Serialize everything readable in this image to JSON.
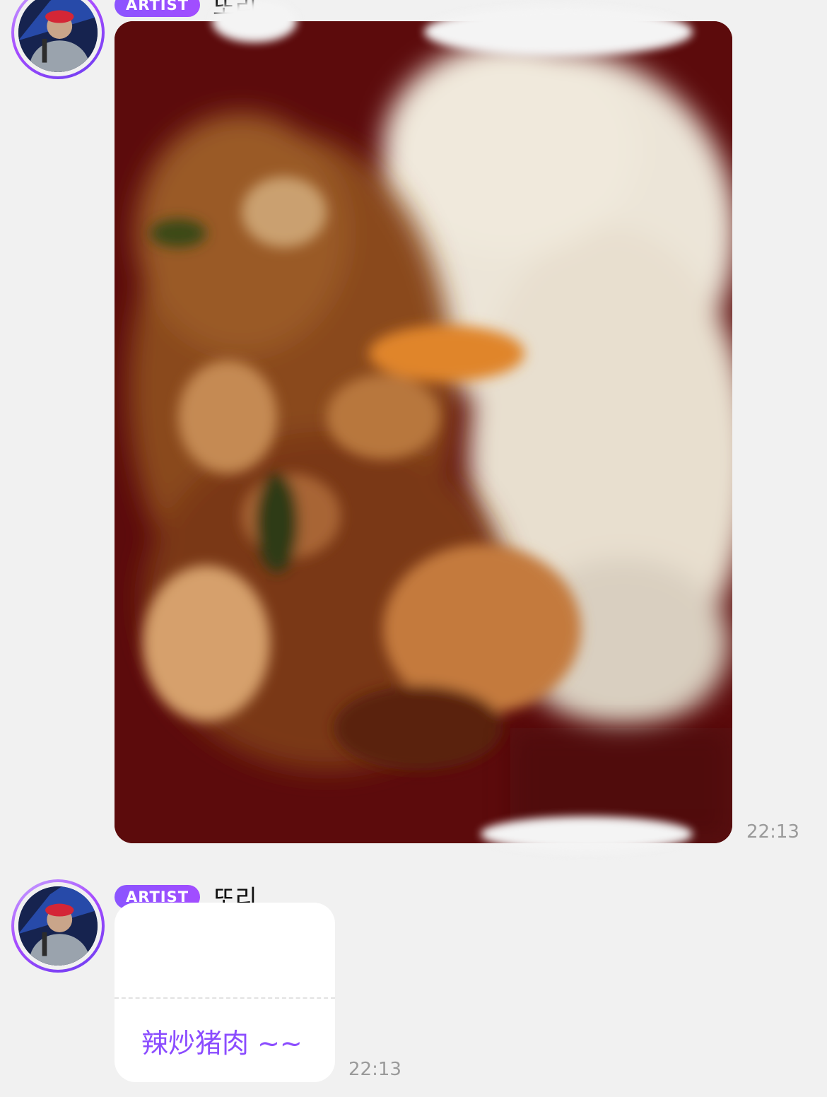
{
  "messages": [
    {
      "badge": "ARTIST",
      "sender": "또리",
      "type": "image",
      "image_icon": "food-photo",
      "time": "22:13"
    },
    {
      "badge": "ARTIST",
      "sender": "또리",
      "type": "text",
      "text": "辣炒猪肉 ~~",
      "time": "22:13"
    }
  ],
  "colors": {
    "background": "#f1f1f1",
    "badge": "#8b54ff",
    "message_text": "#8b4cff",
    "timestamp": "#9a9a9a"
  }
}
